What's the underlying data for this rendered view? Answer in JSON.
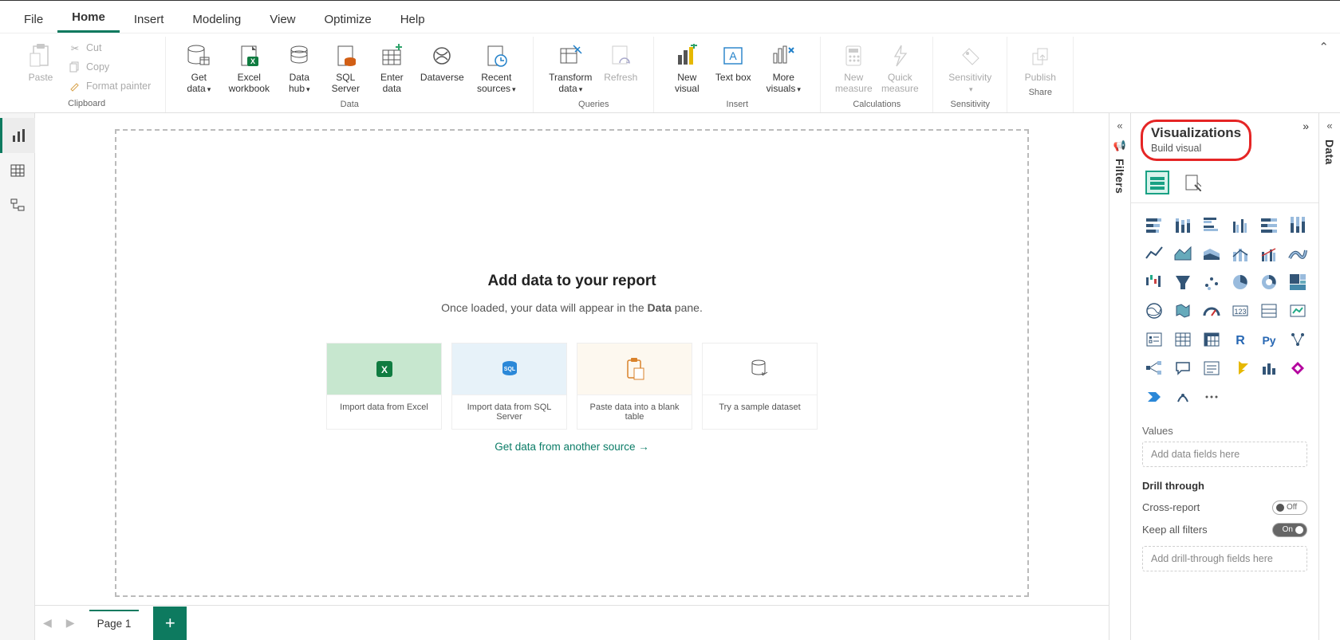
{
  "menu_tabs": [
    "File",
    "Home",
    "Insert",
    "Modeling",
    "View",
    "Optimize",
    "Help"
  ],
  "active_tab": "Home",
  "ribbon": {
    "clipboard": {
      "paste": "Paste",
      "cut": "Cut",
      "copy": "Copy",
      "format_painter": "Format painter",
      "group_label": "Clipboard"
    },
    "data": {
      "get_data": "Get data",
      "excel": "Excel workbook",
      "data_hub": "Data hub",
      "sql": "SQL Server",
      "enter_data": "Enter data",
      "dataverse": "Dataverse",
      "recent": "Recent sources",
      "group_label": "Data"
    },
    "queries": {
      "transform": "Transform data",
      "refresh": "Refresh",
      "group_label": "Queries"
    },
    "insert": {
      "new_visual": "New visual",
      "text_box": "Text box",
      "more_visuals": "More visuals",
      "group_label": "Insert"
    },
    "calculations": {
      "new_measure": "New measure",
      "quick_measure": "Quick measure",
      "group_label": "Calculations"
    },
    "sensitivity": {
      "label": "Sensitivity",
      "group_label": "Sensitivity"
    },
    "share": {
      "publish": "Publish",
      "group_label": "Share"
    }
  },
  "canvas": {
    "title": "Add data to your report",
    "subtitle_prefix": "Once loaded, your data will appear in the ",
    "subtitle_bold": "Data",
    "subtitle_suffix": " pane.",
    "cards": {
      "excel": "Import data from Excel",
      "sql": "Import data from SQL Server",
      "paste": "Paste data into a blank table",
      "sample": "Try a sample dataset"
    },
    "another_source": "Get data from another source →"
  },
  "pages": {
    "page1": "Page 1"
  },
  "panels": {
    "filters": "Filters",
    "visualizations_title": "Visualizations",
    "build_visual": "Build visual",
    "data": "Data",
    "values_label": "Values",
    "values_placeholder": "Add data fields here",
    "drill_label": "Drill through",
    "cross_report": "Cross-report",
    "keep_filters": "Keep all filters",
    "off": "Off",
    "on": "On",
    "drill_placeholder": "Add drill-through fields here"
  },
  "viz_icons": [
    "stacked-bar",
    "stacked-column",
    "clustered-bar",
    "clustered-column",
    "hundred-stacked-bar",
    "hundred-stacked-column",
    "line",
    "area",
    "stacked-area",
    "line-stacked-column",
    "line-clustered-column",
    "ribbon",
    "waterfall",
    "funnel",
    "scatter",
    "pie",
    "donut",
    "treemap",
    "map",
    "filled-map",
    "gauge",
    "card",
    "multi-row-card",
    "kpi",
    "slicer",
    "table",
    "matrix",
    "r-visual",
    "python-visual",
    "key-influencers",
    "decomposition-tree",
    "qa",
    "smart-narrative",
    "paginated",
    "metrics",
    "power-apps",
    "power-automate",
    "arcgis",
    "more"
  ]
}
